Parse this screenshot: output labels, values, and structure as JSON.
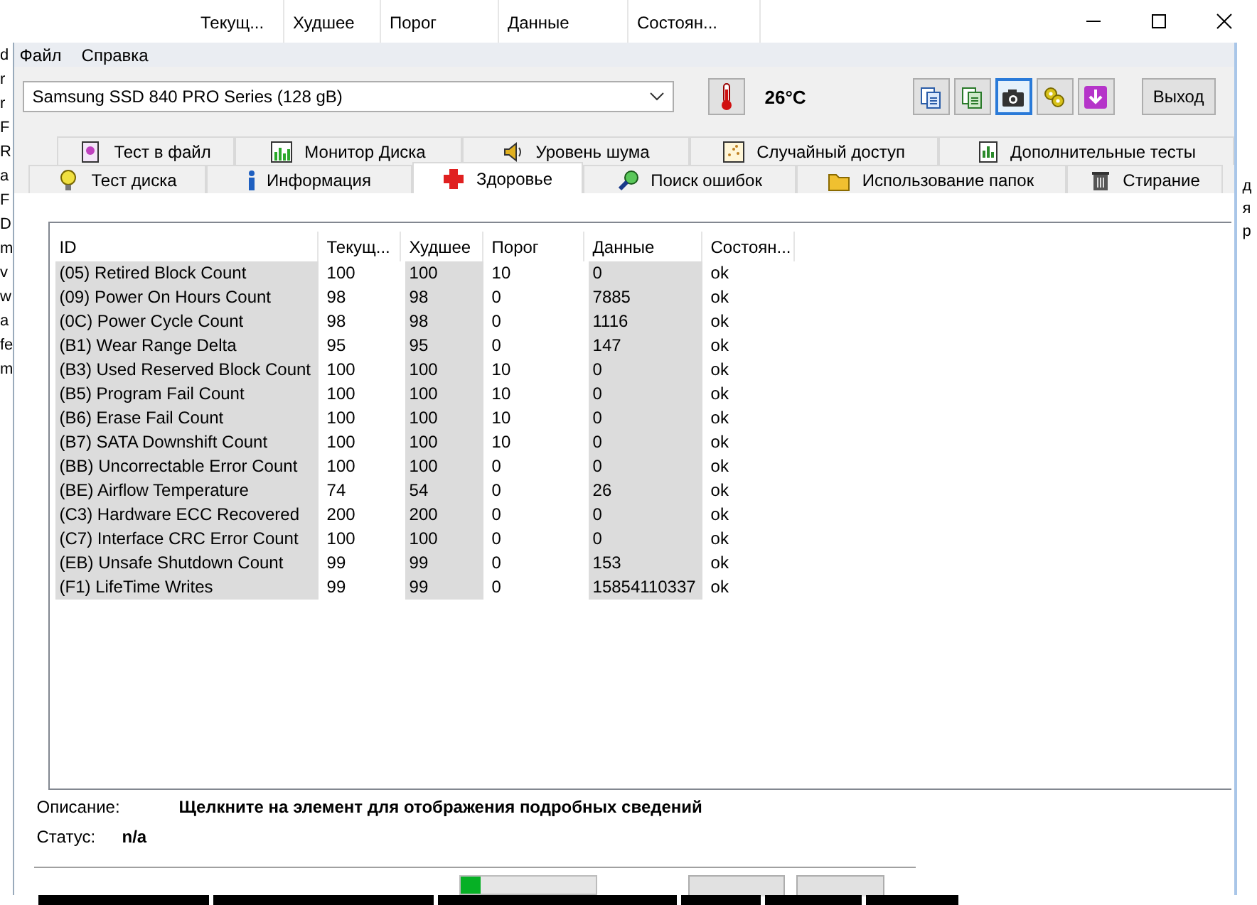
{
  "background_window": {
    "columns": [
      "Текущ...",
      "Худшее",
      "Порог",
      "Данные",
      "Состоян..."
    ],
    "left_fragments": [
      "d",
      "r",
      "r",
      "F",
      "R",
      "a",
      "F",
      "D",
      "m",
      "v",
      "w",
      "a",
      "fe",
      "m"
    ],
    "right_fragments": [
      "д",
      "я",
      "р"
    ]
  },
  "menu": [
    "Файл",
    "Справка"
  ],
  "device_select": {
    "value": "Samsung SSD 840 PRO Series (128 gB)"
  },
  "temperature": "26°C",
  "toolbar": [
    {
      "selected": false
    },
    {
      "selected": false
    },
    {
      "selected": true
    },
    {
      "selected": false
    },
    {
      "selected": false
    }
  ],
  "exit_button": "Выход",
  "tabs": {
    "back_row": [
      {
        "label": "Тест в файл",
        "selected": false
      },
      {
        "label": "Монитор Диска",
        "selected": false
      },
      {
        "label": "Уровень шума",
        "selected": false
      },
      {
        "label": "Случайный доступ",
        "selected": false
      },
      {
        "label": "Дополнительные  тесты",
        "selected": false
      }
    ],
    "front_row": [
      {
        "label": "Тест диска",
        "selected": false
      },
      {
        "label": "Информация",
        "selected": false
      },
      {
        "label": "Здоровье",
        "selected": true
      },
      {
        "label": "Поиск ошибок",
        "selected": false
      },
      {
        "label": "Использование папок",
        "selected": false
      },
      {
        "label": "Стирание",
        "selected": false
      }
    ]
  },
  "table": {
    "columns": [
      {
        "label": "ID",
        "shaded": true
      },
      {
        "label": "Текущ...",
        "shaded": false
      },
      {
        "label": "Худшее",
        "shaded": true
      },
      {
        "label": "Порог",
        "shaded": false
      },
      {
        "label": "Данные",
        "shaded": true
      },
      {
        "label": "Состоян...",
        "shaded": false
      }
    ],
    "rows": [
      [
        "(05) Retired Block Count",
        "100",
        "100",
        "10",
        "0",
        "ok"
      ],
      [
        "(09) Power On Hours Count",
        "98",
        "98",
        "0",
        "7885",
        "ok"
      ],
      [
        "(0C) Power Cycle Count",
        "98",
        "98",
        "0",
        "1116",
        "ok"
      ],
      [
        "(B1) Wear Range Delta",
        "95",
        "95",
        "0",
        "147",
        "ok"
      ],
      [
        "(B3) Used Reserved Block Count",
        "100",
        "100",
        "10",
        "0",
        "ok"
      ],
      [
        "(B5) Program Fail Count",
        "100",
        "100",
        "10",
        "0",
        "ok"
      ],
      [
        "(B6) Erase Fail Count",
        "100",
        "100",
        "10",
        "0",
        "ok"
      ],
      [
        "(B7) SATA Downshift Count",
        "100",
        "100",
        "10",
        "0",
        "ok"
      ],
      [
        "(BB) Uncorrectable Error Count",
        "100",
        "100",
        "0",
        "0",
        "ok"
      ],
      [
        "(BE) Airflow Temperature",
        "74",
        "54",
        "0",
        "26",
        "ok"
      ],
      [
        "(C3) Hardware ECC Recovered",
        "200",
        "200",
        "0",
        "0",
        "ok"
      ],
      [
        "(C7) Interface CRC Error Count",
        "100",
        "100",
        "0",
        "0",
        "ok"
      ],
      [
        "(EB) Unsafe Shutdown Count",
        "99",
        "99",
        "0",
        "153",
        "ok"
      ],
      [
        "(F1) LifeTime Writes",
        "99",
        "99",
        "0",
        "15854110337",
        "ok"
      ]
    ]
  },
  "description": {
    "label": "Описание:",
    "value": "Щелкните на элемент для отображения подробных сведений"
  },
  "status": {
    "label": "Статус:",
    "value": "n/a"
  },
  "progress": {
    "level": 0.15
  }
}
